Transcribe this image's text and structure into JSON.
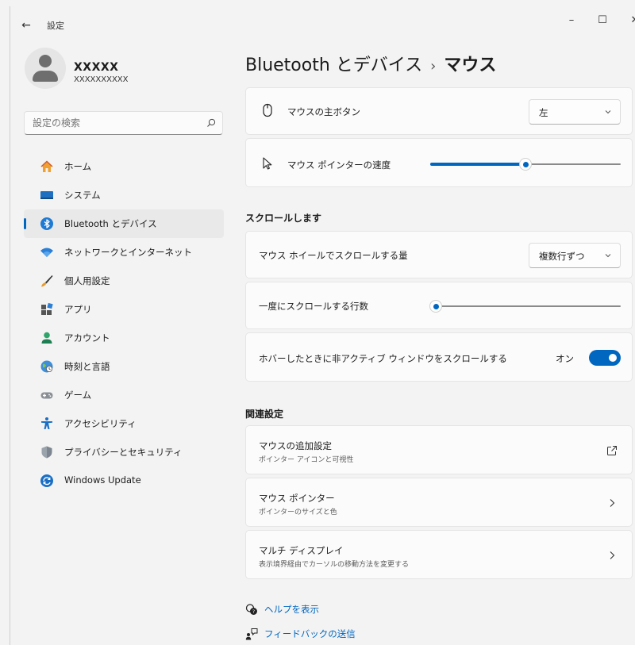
{
  "window": {
    "title": "設定",
    "back_icon": "←",
    "minimize_icon": "–",
    "maximize_icon": "☐",
    "close_icon": "✕"
  },
  "profile": {
    "name": "XXXXX",
    "account": "XXXXXXXXXX"
  },
  "search": {
    "placeholder": "設定の検索"
  },
  "sidebar": {
    "items": [
      {
        "label": "ホーム",
        "icon": "home-icon"
      },
      {
        "label": "システム",
        "icon": "system-icon"
      },
      {
        "label": "Bluetooth とデバイス",
        "icon": "bluetooth-icon",
        "active": true
      },
      {
        "label": "ネットワークとインターネット",
        "icon": "wifi-icon"
      },
      {
        "label": "個人用設定",
        "icon": "brush-icon"
      },
      {
        "label": "アプリ",
        "icon": "apps-icon"
      },
      {
        "label": "アカウント",
        "icon": "account-icon"
      },
      {
        "label": "時刻と言語",
        "icon": "globe-clock-icon"
      },
      {
        "label": "ゲーム",
        "icon": "gamepad-icon"
      },
      {
        "label": "アクセシビリティ",
        "icon": "accessibility-icon"
      },
      {
        "label": "プライバシーとセキュリティ",
        "icon": "shield-icon"
      },
      {
        "label": "Windows Update",
        "icon": "windows-update-icon"
      }
    ]
  },
  "header": {
    "parent": "Bluetooth とデバイス",
    "separator": "›",
    "current": "マウス"
  },
  "settings": {
    "primary_button": {
      "label": "マウスの主ボタン",
      "value": "左"
    },
    "pointer_speed": {
      "label": "マウス ポインターの速度",
      "value_fraction": 0.5
    }
  },
  "scroll_section": {
    "title": "スクロールします",
    "wheel_amount": {
      "label": "マウス ホイールでスクロールする量",
      "value": "複数行ずつ"
    },
    "lines": {
      "label": "一度にスクロールする行数",
      "value_fraction": 0.03
    },
    "inactive_scroll": {
      "label": "ホバーしたときに非アクティブ ウィンドウをスクロールする",
      "state": "オン"
    }
  },
  "related": {
    "title": "関連設定",
    "items": [
      {
        "title": "マウスの追加設定",
        "subtitle": "ポインター アイコンと可視性"
      },
      {
        "title": "マウス ポインター",
        "subtitle": "ポインターのサイズと色"
      },
      {
        "title": "マルチ ディスプレイ",
        "subtitle": "表示境界経由でカーソルの移動方法を変更する"
      }
    ]
  },
  "help": {
    "help_label": "ヘルプを表示",
    "feedback_label": "フィードバックの送信"
  },
  "colors": {
    "accent": "#0067c0",
    "background": "#f3f3f3",
    "card": "#fbfbfb"
  }
}
